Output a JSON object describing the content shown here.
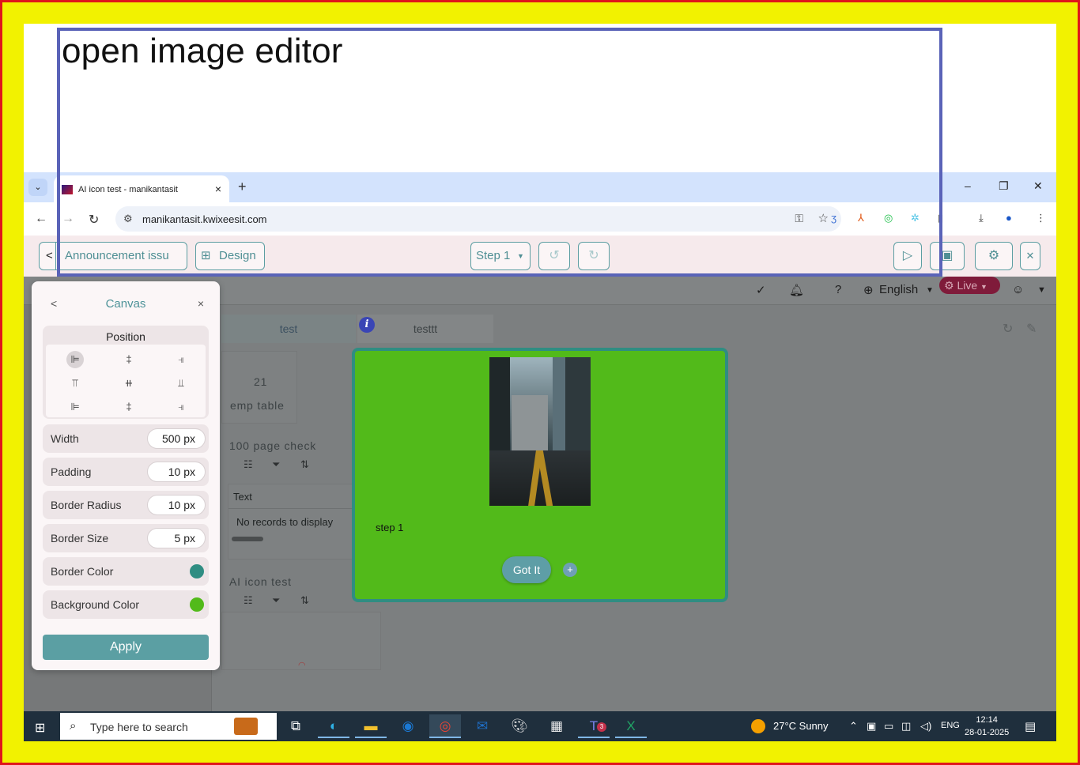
{
  "annotation": {
    "title": "open image editor"
  },
  "browser": {
    "tab_title": "AI icon test - manikantasit",
    "tab_close": "×",
    "new_tab": "+",
    "url": "manikantasit.kwixeesit.com",
    "win_min": "–",
    "win_max": "❐",
    "win_close": "✕"
  },
  "toolbar": {
    "back_label": "<",
    "announcement_label": "Announcement issu",
    "design_label": "Design",
    "step_label": "Step 1",
    "undo": "↺",
    "redo": "↻",
    "play": "▷",
    "save": "▣",
    "settings": "⚙",
    "close": "✕"
  },
  "app": {
    "language": "English",
    "live_label": "Live",
    "tab_test": "test",
    "tab_testtt": "testtt",
    "info_badge": "i",
    "card_count": "21",
    "card_emp_table": "emp table",
    "section_100": "100 page check",
    "col_text": "Text",
    "no_records": "No records to display",
    "section_ai": "AI icon test"
  },
  "canvas_panel": {
    "back": "<",
    "title": "Canvas",
    "close": "×",
    "position_title": "Position",
    "width_label": "Width",
    "width_value": "500 px",
    "padding_label": "Padding",
    "padding_value": "10 px",
    "radius_label": "Border Radius",
    "radius_value": "10 px",
    "size_label": "Border Size",
    "size_value": "5 px",
    "border_color_label": "Border Color",
    "bg_color_label": "Background Color",
    "apply_label": "Apply",
    "colors": {
      "border": "#2f8d82",
      "background": "#52ba1a",
      "accent": "#5b9fa3"
    }
  },
  "modal": {
    "step_text": "step 1",
    "gotit_label": "Got It",
    "plus": "+"
  },
  "taskbar": {
    "search_placeholder": "Type here to search",
    "weather": "27°C  Sunny",
    "lang": "ENG",
    "time": "12:14",
    "date": "28-01-2025",
    "teams_badge": "3"
  }
}
